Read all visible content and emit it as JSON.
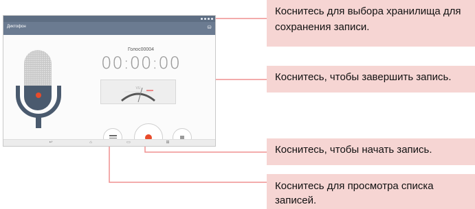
{
  "device": {
    "app_title": "Диктофон",
    "file_name": "Голос00004",
    "timer": "00:00:00",
    "vu_label": "VU",
    "icons": {
      "storage": "sd-card-icon",
      "microphone": "microphone-icon",
      "list": "list-icon",
      "record": "record-icon",
      "stop": "stop-icon",
      "back": "back-icon",
      "home": "home-icon",
      "recent": "recent-apps-icon",
      "menu": "menu-icon"
    }
  },
  "callouts": {
    "storage": "Коснитесь для выбора хранилища для сохранения записи.",
    "stop": "Коснитесь, чтобы завершить запись.",
    "record": "Коснитесь, чтобы начать запись.",
    "list": "Коснитесь для просмотра списка записей."
  },
  "colors": {
    "callout_bg": "#f6d5d3",
    "leader_line": "#ef8f8f",
    "record": "#e84b2b",
    "appbar": "#6b7b91"
  }
}
